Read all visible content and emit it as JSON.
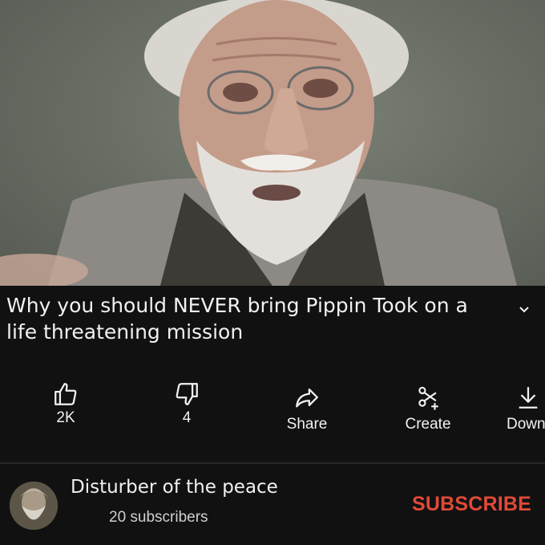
{
  "video": {
    "title": "Why you should NEVER bring Pippin Took on a life threatening mission"
  },
  "actions": {
    "like_count": "2K",
    "dislike_count": "4",
    "share_label": "Share",
    "create_label": "Create",
    "download_label": "Down"
  },
  "channel": {
    "name": "Disturber of the peace",
    "subscribers": "20 subscribers",
    "subscribe_label": "SUBSCRIBE"
  },
  "colors": {
    "background": "#0f0f0f",
    "subscribe_red": "#e04a38",
    "text": "#f1f1f1"
  }
}
